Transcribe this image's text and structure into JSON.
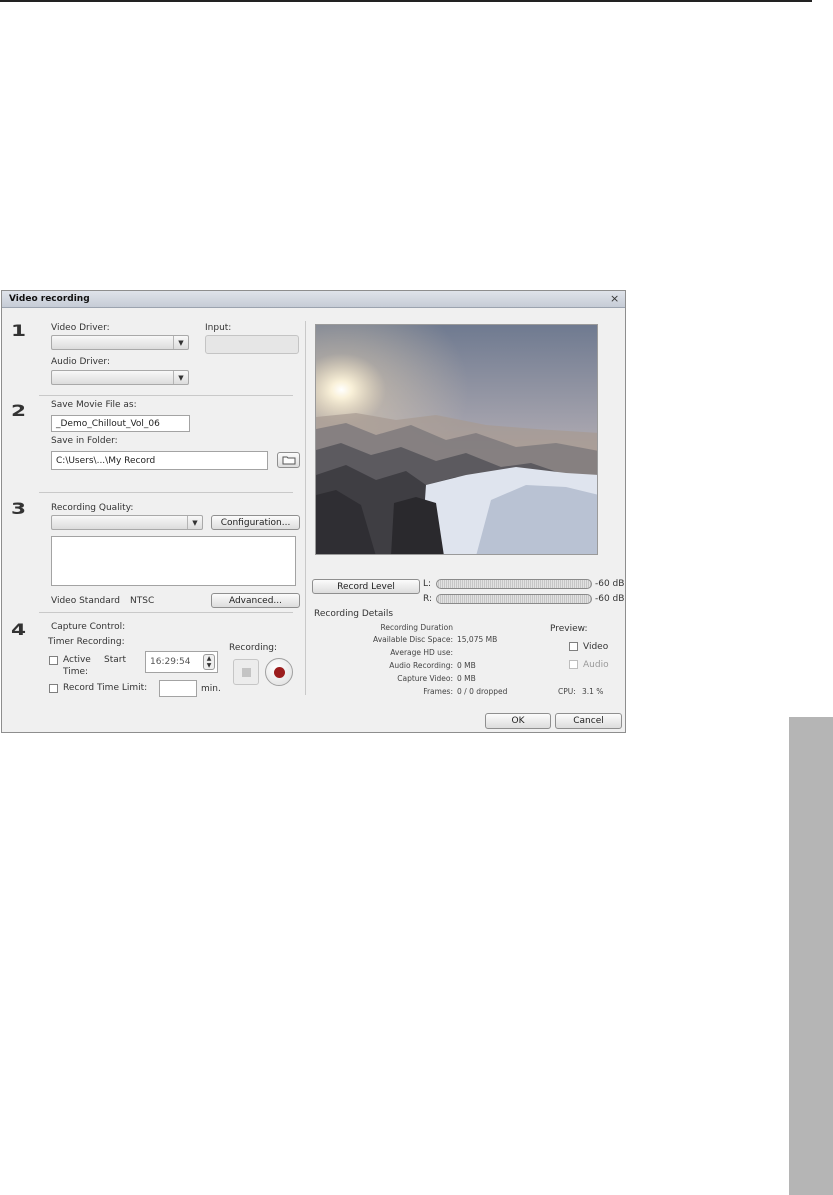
{
  "dialog": {
    "title": "Video recording",
    "close_glyph": "×"
  },
  "section1": {
    "number": "1",
    "video_driver_label": "Video Driver:",
    "video_driver_value": "",
    "input_label": "Input:",
    "input_value": "",
    "audio_driver_label": "Audio Driver:",
    "audio_driver_value": ""
  },
  "section2": {
    "number": "2",
    "save_movie_label": "Save Movie File as:",
    "save_movie_value": "_Demo_Chillout_Vol_06",
    "save_folder_label": "Save in Folder:",
    "save_folder_value": "C:\\Users\\...\\My Record",
    "folder_icon": "folder-icon"
  },
  "section3": {
    "number": "3",
    "quality_label": "Recording Quality:",
    "quality_value": "",
    "configuration_button": "Configuration...",
    "description_text": "",
    "video_standard_label": "Video Standard",
    "video_standard_value": "NTSC",
    "advanced_button": "Advanced..."
  },
  "section4": {
    "number": "4",
    "capture_control_label": "Capture Control:",
    "timer_recording_label": "Timer Recording:",
    "active_label": "Active",
    "time_label": "Time:",
    "start_label": "Start",
    "start_time_value": "16:29:54",
    "record_time_limit_label": "Record Time Limit:",
    "time_limit_value": "",
    "min_label": "min.",
    "recording_label": "Recording:"
  },
  "levels": {
    "record_level_button": "Record Level",
    "left_label": "L:",
    "right_label": "R:",
    "left_db": "-60 dB",
    "right_db": "-60 dB",
    "left_level_fraction": 0,
    "right_level_fraction": 0
  },
  "details": {
    "heading": "Recording Details",
    "recording_duration_label": "Recording Duration",
    "available_disc_space_label": "Available Disc Space:",
    "available_disc_space_value": "15,075 MB",
    "average_hd_use_label": "Average HD use:",
    "average_hd_use_value": "",
    "audio_recording_label": "Audio Recording:",
    "audio_recording_value": "0 MB",
    "capture_video_label": "Capture Video:",
    "capture_video_value": "0 MB",
    "frames_label": "Frames:",
    "frames_value": "0 / 0 dropped"
  },
  "preview": {
    "heading": "Preview:",
    "video_label": "Video",
    "audio_label": "Audio",
    "cpu_label": "CPU:",
    "cpu_value": "3.1 %"
  },
  "footer": {
    "ok_button": "OK",
    "cancel_button": "Cancel"
  },
  "colors": {
    "dialog_background": "#f0f0f0",
    "record_dot": "#9b1c1c",
    "side_tab": "#b5b5b5"
  }
}
